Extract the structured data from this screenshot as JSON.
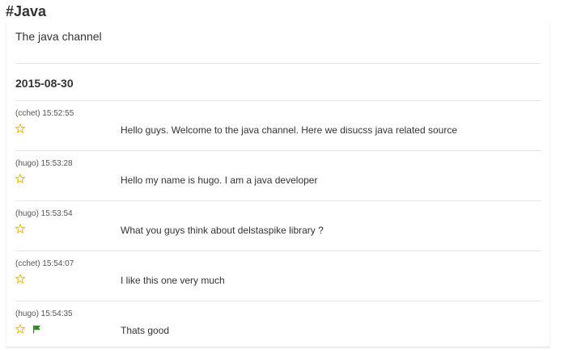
{
  "channel": {
    "name": "#Java",
    "description": "The java channel"
  },
  "log": {
    "date": "2015-08-30",
    "messages": [
      {
        "user": "(cchet)",
        "time": "15:52:55",
        "meta": "(cchet) 15:52:55",
        "text": "Hello guys. Welcome to the java channel. Here we disucss java related source",
        "icons": [
          "star-icon"
        ]
      },
      {
        "user": "(hugo)",
        "time": "15:53:28",
        "meta": "(hugo) 15:53:28",
        "text": "Hello my name is hugo. I am a java developer",
        "icons": [
          "star-icon"
        ]
      },
      {
        "user": "(hugo)",
        "time": "15:53:54",
        "meta": "(hugo) 15:53:54",
        "text": "What you guys think about delstaspike library ?",
        "icons": [
          "star-icon"
        ]
      },
      {
        "user": "(cchet)",
        "time": "15:54:07",
        "meta": "(cchet) 15:54:07",
        "text": "I like this one very much",
        "icons": [
          "star-icon"
        ]
      },
      {
        "user": "(hugo)",
        "time": "15:54:35",
        "meta": "(hugo) 15:54:35",
        "text": "Thats good",
        "icons": [
          "star-icon",
          "flag-icon"
        ]
      }
    ]
  },
  "colors": {
    "star": "#f0b800",
    "flag": "#2e8b1e",
    "text": "#333333",
    "divider": "#e6e6e6"
  }
}
